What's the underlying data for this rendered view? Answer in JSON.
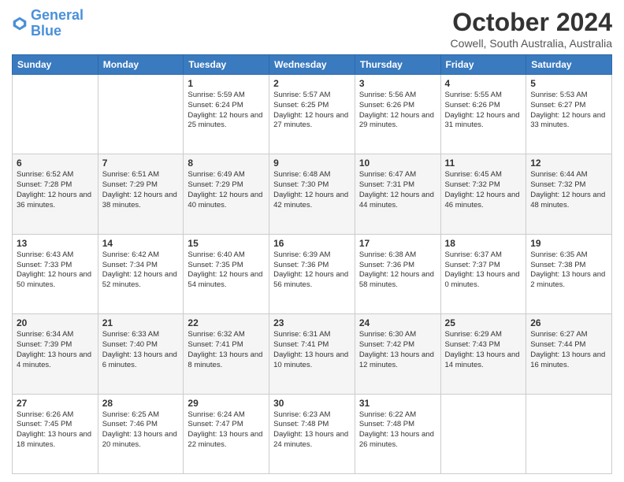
{
  "logo": {
    "line1": "General",
    "line2": "Blue"
  },
  "title": "October 2024",
  "subtitle": "Cowell, South Australia, Australia",
  "weekdays": [
    "Sunday",
    "Monday",
    "Tuesday",
    "Wednesday",
    "Thursday",
    "Friday",
    "Saturday"
  ],
  "rows": [
    [
      {
        "day": "",
        "sunrise": "",
        "sunset": "",
        "daylight": ""
      },
      {
        "day": "",
        "sunrise": "",
        "sunset": "",
        "daylight": ""
      },
      {
        "day": "1",
        "sunrise": "Sunrise: 5:59 AM",
        "sunset": "Sunset: 6:24 PM",
        "daylight": "Daylight: 12 hours and 25 minutes."
      },
      {
        "day": "2",
        "sunrise": "Sunrise: 5:57 AM",
        "sunset": "Sunset: 6:25 PM",
        "daylight": "Daylight: 12 hours and 27 minutes."
      },
      {
        "day": "3",
        "sunrise": "Sunrise: 5:56 AM",
        "sunset": "Sunset: 6:26 PM",
        "daylight": "Daylight: 12 hours and 29 minutes."
      },
      {
        "day": "4",
        "sunrise": "Sunrise: 5:55 AM",
        "sunset": "Sunset: 6:26 PM",
        "daylight": "Daylight: 12 hours and 31 minutes."
      },
      {
        "day": "5",
        "sunrise": "Sunrise: 5:53 AM",
        "sunset": "Sunset: 6:27 PM",
        "daylight": "Daylight: 12 hours and 33 minutes."
      }
    ],
    [
      {
        "day": "6",
        "sunrise": "Sunrise: 6:52 AM",
        "sunset": "Sunset: 7:28 PM",
        "daylight": "Daylight: 12 hours and 36 minutes."
      },
      {
        "day": "7",
        "sunrise": "Sunrise: 6:51 AM",
        "sunset": "Sunset: 7:29 PM",
        "daylight": "Daylight: 12 hours and 38 minutes."
      },
      {
        "day": "8",
        "sunrise": "Sunrise: 6:49 AM",
        "sunset": "Sunset: 7:29 PM",
        "daylight": "Daylight: 12 hours and 40 minutes."
      },
      {
        "day": "9",
        "sunrise": "Sunrise: 6:48 AM",
        "sunset": "Sunset: 7:30 PM",
        "daylight": "Daylight: 12 hours and 42 minutes."
      },
      {
        "day": "10",
        "sunrise": "Sunrise: 6:47 AM",
        "sunset": "Sunset: 7:31 PM",
        "daylight": "Daylight: 12 hours and 44 minutes."
      },
      {
        "day": "11",
        "sunrise": "Sunrise: 6:45 AM",
        "sunset": "Sunset: 7:32 PM",
        "daylight": "Daylight: 12 hours and 46 minutes."
      },
      {
        "day": "12",
        "sunrise": "Sunrise: 6:44 AM",
        "sunset": "Sunset: 7:32 PM",
        "daylight": "Daylight: 12 hours and 48 minutes."
      }
    ],
    [
      {
        "day": "13",
        "sunrise": "Sunrise: 6:43 AM",
        "sunset": "Sunset: 7:33 PM",
        "daylight": "Daylight: 12 hours and 50 minutes."
      },
      {
        "day": "14",
        "sunrise": "Sunrise: 6:42 AM",
        "sunset": "Sunset: 7:34 PM",
        "daylight": "Daylight: 12 hours and 52 minutes."
      },
      {
        "day": "15",
        "sunrise": "Sunrise: 6:40 AM",
        "sunset": "Sunset: 7:35 PM",
        "daylight": "Daylight: 12 hours and 54 minutes."
      },
      {
        "day": "16",
        "sunrise": "Sunrise: 6:39 AM",
        "sunset": "Sunset: 7:36 PM",
        "daylight": "Daylight: 12 hours and 56 minutes."
      },
      {
        "day": "17",
        "sunrise": "Sunrise: 6:38 AM",
        "sunset": "Sunset: 7:36 PM",
        "daylight": "Daylight: 12 hours and 58 minutes."
      },
      {
        "day": "18",
        "sunrise": "Sunrise: 6:37 AM",
        "sunset": "Sunset: 7:37 PM",
        "daylight": "Daylight: 13 hours and 0 minutes."
      },
      {
        "day": "19",
        "sunrise": "Sunrise: 6:35 AM",
        "sunset": "Sunset: 7:38 PM",
        "daylight": "Daylight: 13 hours and 2 minutes."
      }
    ],
    [
      {
        "day": "20",
        "sunrise": "Sunrise: 6:34 AM",
        "sunset": "Sunset: 7:39 PM",
        "daylight": "Daylight: 13 hours and 4 minutes."
      },
      {
        "day": "21",
        "sunrise": "Sunrise: 6:33 AM",
        "sunset": "Sunset: 7:40 PM",
        "daylight": "Daylight: 13 hours and 6 minutes."
      },
      {
        "day": "22",
        "sunrise": "Sunrise: 6:32 AM",
        "sunset": "Sunset: 7:41 PM",
        "daylight": "Daylight: 13 hours and 8 minutes."
      },
      {
        "day": "23",
        "sunrise": "Sunrise: 6:31 AM",
        "sunset": "Sunset: 7:41 PM",
        "daylight": "Daylight: 13 hours and 10 minutes."
      },
      {
        "day": "24",
        "sunrise": "Sunrise: 6:30 AM",
        "sunset": "Sunset: 7:42 PM",
        "daylight": "Daylight: 13 hours and 12 minutes."
      },
      {
        "day": "25",
        "sunrise": "Sunrise: 6:29 AM",
        "sunset": "Sunset: 7:43 PM",
        "daylight": "Daylight: 13 hours and 14 minutes."
      },
      {
        "day": "26",
        "sunrise": "Sunrise: 6:27 AM",
        "sunset": "Sunset: 7:44 PM",
        "daylight": "Daylight: 13 hours and 16 minutes."
      }
    ],
    [
      {
        "day": "27",
        "sunrise": "Sunrise: 6:26 AM",
        "sunset": "Sunset: 7:45 PM",
        "daylight": "Daylight: 13 hours and 18 minutes."
      },
      {
        "day": "28",
        "sunrise": "Sunrise: 6:25 AM",
        "sunset": "Sunset: 7:46 PM",
        "daylight": "Daylight: 13 hours and 20 minutes."
      },
      {
        "day": "29",
        "sunrise": "Sunrise: 6:24 AM",
        "sunset": "Sunset: 7:47 PM",
        "daylight": "Daylight: 13 hours and 22 minutes."
      },
      {
        "day": "30",
        "sunrise": "Sunrise: 6:23 AM",
        "sunset": "Sunset: 7:48 PM",
        "daylight": "Daylight: 13 hours and 24 minutes."
      },
      {
        "day": "31",
        "sunrise": "Sunrise: 6:22 AM",
        "sunset": "Sunset: 7:48 PM",
        "daylight": "Daylight: 13 hours and 26 minutes."
      },
      {
        "day": "",
        "sunrise": "",
        "sunset": "",
        "daylight": ""
      },
      {
        "day": "",
        "sunrise": "",
        "sunset": "",
        "daylight": ""
      }
    ]
  ]
}
